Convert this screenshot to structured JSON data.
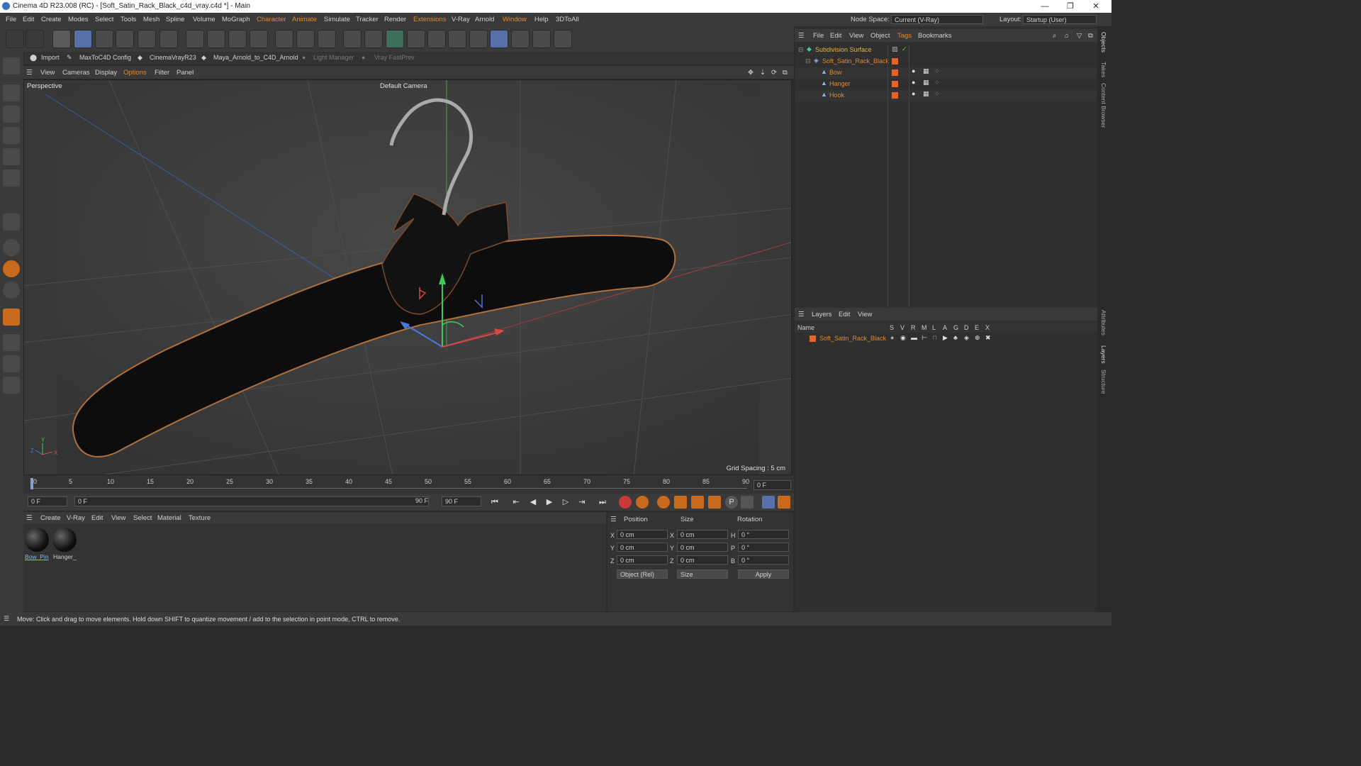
{
  "titlebar": {
    "title": "Cinema 4D R23.008 (RC) - [Soft_Satin_Rack_Black_c4d_vray.c4d *] - Main"
  },
  "menubar": {
    "items": [
      "File",
      "Edit",
      "Create",
      "Modes",
      "Select",
      "Tools",
      "Mesh",
      "Spline",
      "Volume",
      "MoGraph",
      "Character",
      "Animate",
      "Simulate",
      "Tracker",
      "Render",
      "Extensions",
      "V-Ray",
      "Arnold",
      "Window",
      "Help",
      "3DToAll"
    ],
    "node_space_label": "Node Space:",
    "node_space_value": "Current (V-Ray)",
    "layout_label": "Layout:",
    "layout_value": "Startup (User)"
  },
  "plugbar": {
    "items": [
      "Import",
      "MaxToC4D Config",
      "CinemaVrayR23",
      "Maya_Arnold_to_C4D_Arnold",
      "Light Manager",
      "Vray FastPrev"
    ]
  },
  "viewport_menu": {
    "items": [
      "View",
      "Cameras",
      "Display",
      "Options",
      "Filter",
      "Panel"
    ]
  },
  "viewport": {
    "label": "Perspective",
    "camera": "Default Camera",
    "grid": "Grid Spacing : 5 cm"
  },
  "timeline": {
    "ticks": [
      "0",
      "5",
      "10",
      "15",
      "20",
      "25",
      "30",
      "35",
      "40",
      "45",
      "50",
      "55",
      "60",
      "65",
      "70",
      "75",
      "80",
      "85",
      "90"
    ],
    "current": "0 F"
  },
  "transport": {
    "start": "0 F",
    "current": "0 F",
    "end_a": "90 F",
    "end_b": "90 F"
  },
  "material_menu": {
    "items": [
      "Create",
      "V-Ray",
      "Edit",
      "View",
      "Select",
      "Material",
      "Texture"
    ]
  },
  "materials": [
    {
      "name": "Bow_Pin"
    },
    {
      "name": "Hanger_"
    }
  ],
  "coords": {
    "headers": {
      "position": "Position",
      "size": "Size",
      "rotation": "Rotation"
    },
    "rows": [
      {
        "axis": "X",
        "pos": "0 cm",
        "saxis": "X",
        "size": "0 cm",
        "raxis": "H",
        "rot": "0 °"
      },
      {
        "axis": "Y",
        "pos": "0 cm",
        "saxis": "Y",
        "size": "0 cm",
        "raxis": "P",
        "rot": "0 °"
      },
      {
        "axis": "Z",
        "pos": "0 cm",
        "saxis": "Z",
        "size": "0 cm",
        "raxis": "B",
        "rot": "0 °"
      }
    ],
    "mode": "Object (Rel)",
    "size_mode": "Size",
    "apply": "Apply"
  },
  "objects_menu": {
    "items": [
      "File",
      "Edit",
      "View",
      "Object",
      "Tags",
      "Bookmarks"
    ]
  },
  "objects": [
    {
      "name": "Subdivision Surface",
      "indent": 0,
      "color": "#e3a53c"
    },
    {
      "name": "Soft_Satin_Rack_Black",
      "indent": 1,
      "color": "#e08a2c"
    },
    {
      "name": "Bow",
      "indent": 2,
      "color": "#e08a2c"
    },
    {
      "name": "Hanger",
      "indent": 2,
      "color": "#e08a2c"
    },
    {
      "name": "Hook",
      "indent": 2,
      "color": "#e08a2c"
    }
  ],
  "layers_menu": {
    "items": [
      "Layers",
      "Edit",
      "View"
    ]
  },
  "layers_header": {
    "name": "Name",
    "cols": [
      "S",
      "V",
      "R",
      "M",
      "L",
      "A",
      "G",
      "D",
      "E",
      "X"
    ]
  },
  "layers": [
    {
      "name": "Soft_Satin_Rack_Black"
    }
  ],
  "side_tabs": [
    "Objects",
    "Takes",
    "Content Browser",
    "Attributes",
    "Layers",
    "Structure"
  ],
  "status": "Move: Click and drag to move elements. Hold down SHIFT to quantize movement / add to the selection in point mode, CTRL to remove."
}
